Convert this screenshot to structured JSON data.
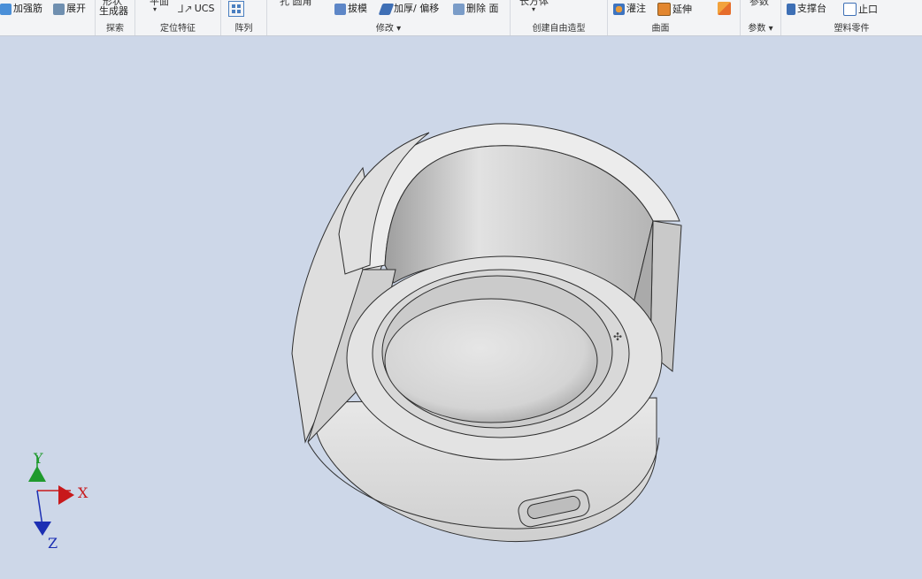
{
  "ribbon": {
    "groups": [
      {
        "label": "",
        "buttons": [
          {
            "label": "加强筋",
            "icon": "rib-icon"
          },
          {
            "label": "展开",
            "icon": "unfold-icon"
          }
        ]
      },
      {
        "label": "探索",
        "buttons": [
          {
            "label": "生成器",
            "icon": "generator-icon"
          }
        ],
        "cut": "形状"
      },
      {
        "label": "定位特征",
        "buttons": [
          {
            "label": "UCS",
            "icon": "ucs-icon"
          }
        ],
        "cut": "平面"
      },
      {
        "label": "阵列",
        "buttons": [
          {
            "label": "",
            "icon": "pattern-icon"
          }
        ]
      },
      {
        "label": "修改 ▾",
        "buttons": [
          {
            "label": "拔模",
            "icon": "draft-icon"
          },
          {
            "label": "加厚/ 偏移",
            "icon": "thicken-icon"
          },
          {
            "label": "删除 面",
            "icon": "delete-face-icon"
          }
        ],
        "cut": "孔     圆角"
      },
      {
        "label": "创建自由造型",
        "buttons": [
          {
            "label": "",
            "icon": "freeform-icon"
          }
        ],
        "cut": "长方体"
      },
      {
        "label": "曲面",
        "buttons": [
          {
            "label": "灌注",
            "icon": "sculpt-icon"
          },
          {
            "label": "延伸",
            "icon": "extend-icon"
          }
        ]
      },
      {
        "label": "参数 ▾",
        "buttons": [
          {
            "label": "",
            "icon": "parameters-icon"
          }
        ],
        "cut": "参数"
      },
      {
        "label": "塑料零件",
        "buttons": [
          {
            "label": "支撑台",
            "icon": "boss-icon"
          },
          {
            "label": "止口",
            "icon": "lip-icon"
          }
        ]
      }
    ]
  },
  "viewcube_axes": {
    "x": "X",
    "y": "Y",
    "z": "Z"
  },
  "colors": {
    "viewport_bg": "#cdd7e8",
    "x_axis": "#c8191b",
    "y_axis": "#1f9a2d",
    "z_axis": "#1c2fb3"
  }
}
